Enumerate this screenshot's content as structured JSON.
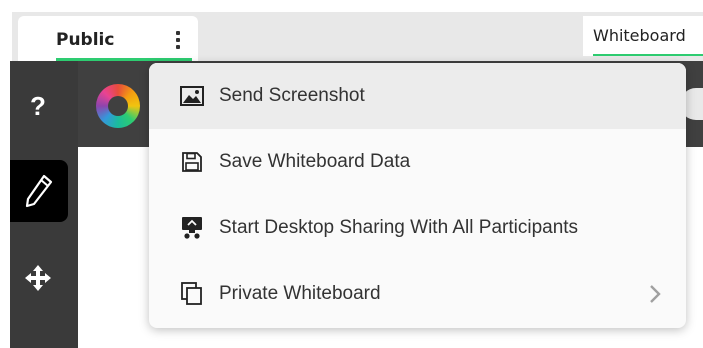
{
  "tabs": {
    "public_label": "Public",
    "whiteboard_label": "Whiteboard"
  },
  "menu": {
    "items": [
      {
        "label": "Send Screenshot",
        "icon": "image-icon"
      },
      {
        "label": "Save Whiteboard Data",
        "icon": "floppy-disk-icon"
      },
      {
        "label": "Start Desktop Sharing With All Participants",
        "icon": "desktop-share-icon"
      },
      {
        "label": "Private Whiteboard",
        "icon": "copy-icon",
        "submenu": true
      }
    ]
  },
  "sidebar": {
    "tools": [
      {
        "name": "help",
        "glyph": "?"
      },
      {
        "name": "pencil",
        "active": true
      },
      {
        "name": "move"
      }
    ]
  },
  "colors": {
    "accent": "#2ecc71",
    "sidebar_bg": "#3a3a3a",
    "menu_bg": "#fafafa"
  }
}
